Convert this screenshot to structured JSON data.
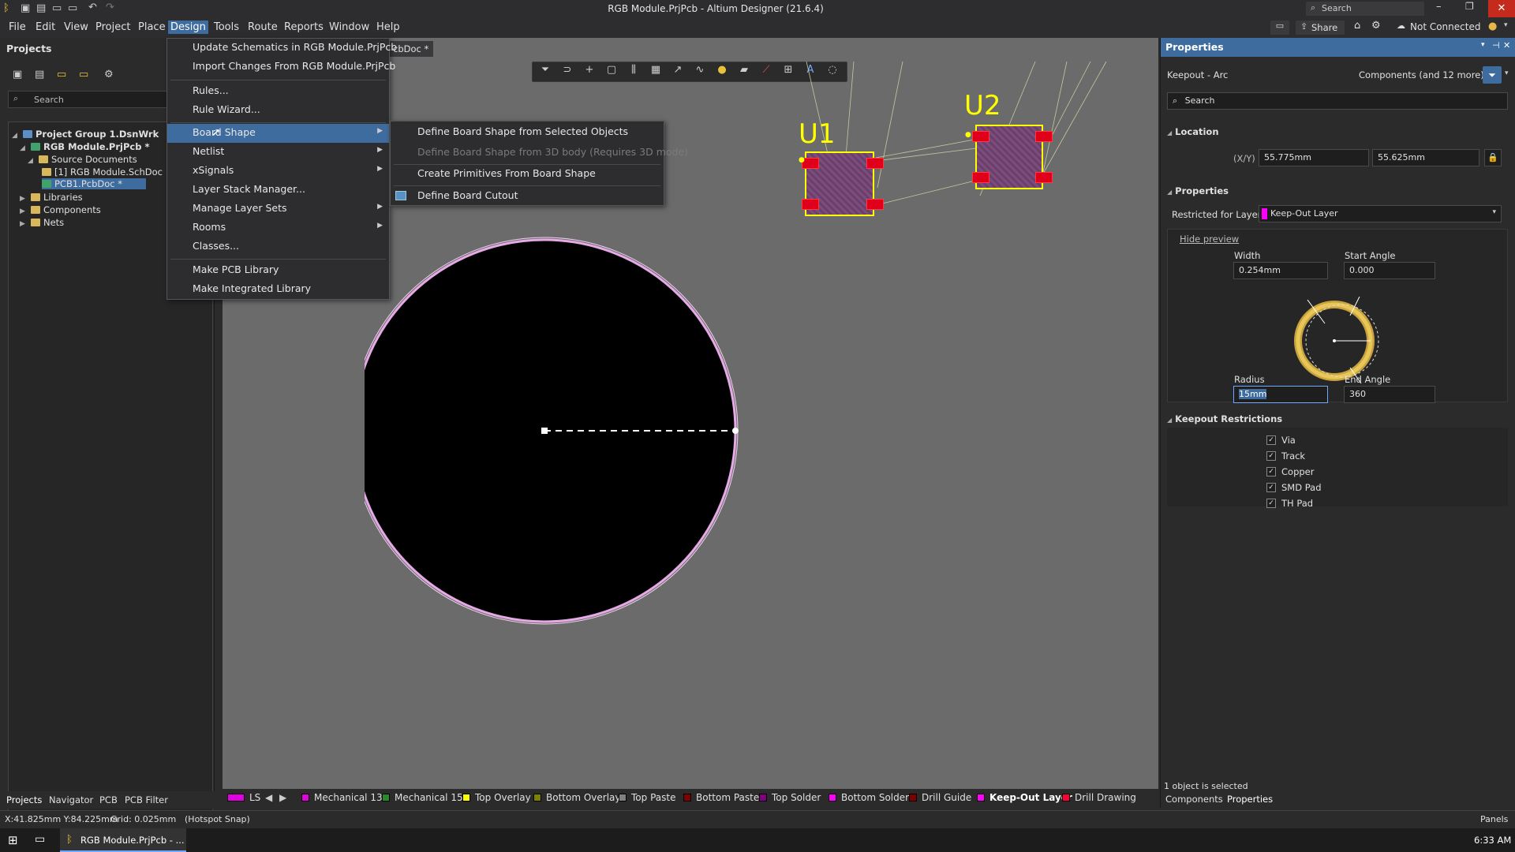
{
  "window": {
    "title": "RGB Module.PrjPcb - Altium Designer (21.6.4)",
    "search_placeholder": "Search"
  },
  "topright": {
    "share": "Share",
    "connection": "Not Connected"
  },
  "menubar": [
    "File",
    "Edit",
    "View",
    "Project",
    "Place",
    "Design",
    "Tools",
    "Route",
    "Reports",
    "Window",
    "Help"
  ],
  "projects_panel": {
    "title": "Projects",
    "search_placeholder": "Search",
    "tree": [
      {
        "label": "Project Group 1.DsnWrk"
      },
      {
        "label": "RGB Module.PrjPcb *"
      },
      {
        "label": "Source Documents"
      },
      {
        "label": "[1] RGB Module.SchDoc"
      },
      {
        "label": "PCB1.PcbDoc *"
      },
      {
        "label": "Libraries"
      },
      {
        "label": "Components"
      },
      {
        "label": "Nets"
      }
    ],
    "bottom_tabs": [
      "Projects",
      "Navigator",
      "PCB",
      "PCB Filter"
    ]
  },
  "doc_tab": "cbDoc *",
  "design_menu": {
    "items": [
      {
        "label": "Update Schematics in RGB Module.PrjPcb"
      },
      {
        "label": "Import Changes From RGB Module.PrjPcb"
      },
      {
        "label": "Rules..."
      },
      {
        "label": "Rule Wizard..."
      },
      {
        "label": "Board Shape"
      },
      {
        "label": "Netlist"
      },
      {
        "label": "xSignals"
      },
      {
        "label": "Layer Stack Manager..."
      },
      {
        "label": "Manage Layer Sets"
      },
      {
        "label": "Rooms"
      },
      {
        "label": "Classes..."
      },
      {
        "label": "Make PCB Library"
      },
      {
        "label": "Make Integrated Library"
      }
    ]
  },
  "board_shape_submenu": {
    "items": [
      {
        "label": "Define Board Shape from Selected Objects"
      },
      {
        "label": "Define Board Shape from 3D body (Requires 3D mode)"
      },
      {
        "label": "Create Primitives From Board Shape"
      },
      {
        "label": "Define Board Cutout"
      }
    ]
  },
  "canvas": {
    "designators": [
      "U1",
      "U2"
    ]
  },
  "properties": {
    "title": "Properties",
    "object_type": "Keepout - Arc",
    "filter_label": "Components (and 12 more)",
    "search_placeholder": "Search",
    "location": {
      "section": "Location",
      "label": "(X/Y)",
      "x": "55.775mm",
      "y": "55.625mm"
    },
    "props_section": "Properties",
    "restricted_label": "Restricted for Layer",
    "layer": "Keep-Out Layer",
    "hide_preview": "Hide preview",
    "width_label": "Width",
    "width": "0.254mm",
    "start_angle_label": "Start Angle",
    "start_angle": "0.000",
    "radius_label": "Radius",
    "radius": "15mm",
    "end_angle_label": "End Angle",
    "end_angle": "360",
    "keepout_section": "Keepout Restrictions",
    "restrictions": [
      "Via",
      "Track",
      "Copper",
      "SMD Pad",
      "TH Pad"
    ],
    "selection_status": "1 object is selected",
    "bottom_tabs": [
      "Components",
      "Properties"
    ]
  },
  "layer_tabs": [
    {
      "label": "LS",
      "color": "#e000e0"
    },
    {
      "label": "Mechanical 13",
      "color": "#e000e0"
    },
    {
      "label": "Mechanical 15",
      "color": "#2a8a2a"
    },
    {
      "label": "Top Overlay",
      "color": "#ffff00"
    },
    {
      "label": "Bottom Overlay",
      "color": "#808000"
    },
    {
      "label": "Top Paste",
      "color": "#808080"
    },
    {
      "label": "Bottom Paste",
      "color": "#800000"
    },
    {
      "label": "Top Solder",
      "color": "#800080"
    },
    {
      "label": "Bottom Solder",
      "color": "#ff00ff"
    },
    {
      "label": "Drill Guide",
      "color": "#800000"
    },
    {
      "label": "Keep-Out Layer",
      "color": "#ff00ff"
    },
    {
      "label": "Drill Drawing",
      "color": "#ff0033"
    }
  ],
  "statusbar": {
    "coords": "X:41.825mm Y:84.225mm",
    "grid": "Grid: 0.025mm",
    "snap": "(Hotspot Snap)",
    "panels": "Panels"
  },
  "taskbar": {
    "app": "RGB Module.PrjPcb - ...",
    "time": "6:33 AM"
  }
}
